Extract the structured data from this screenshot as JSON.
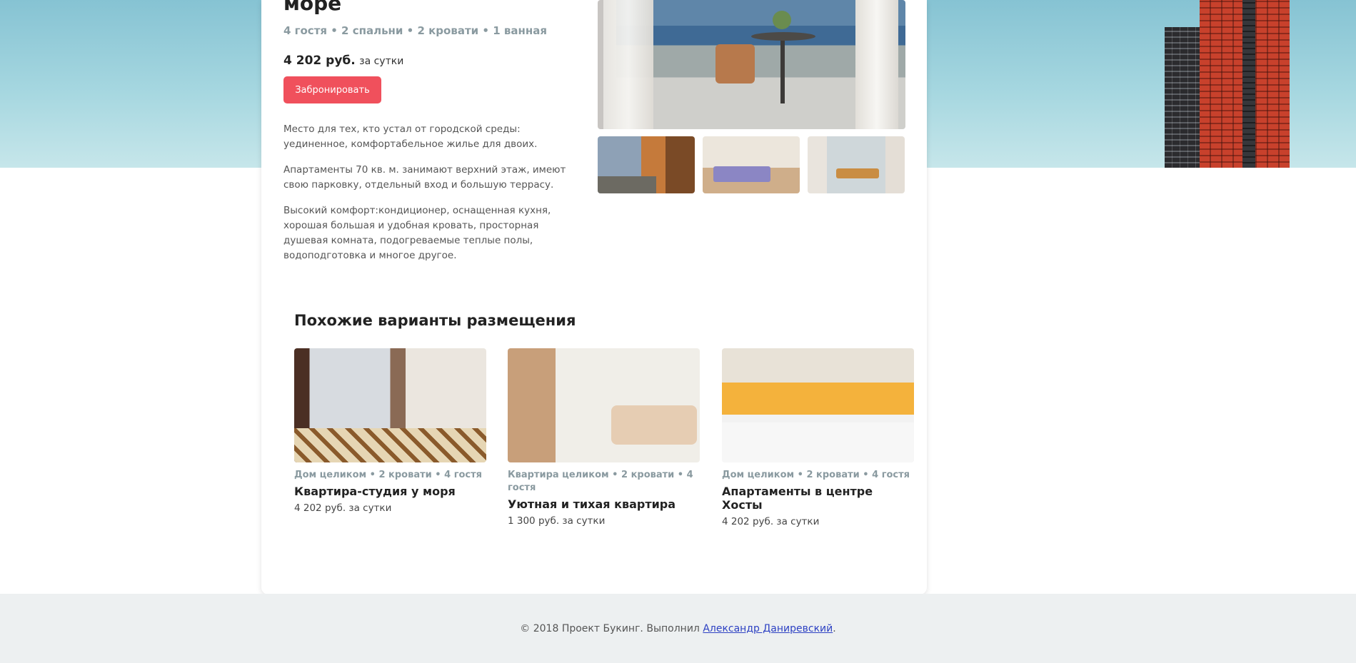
{
  "listing": {
    "title": "море",
    "specs": "4 гостя • 2 спальни • 2 кровати • 1 ванная",
    "price_amount": "4 202 руб.",
    "price_period": "за сутки",
    "book_label": "Забронировать",
    "description": [
      "Место для тех, кто устал от городской среды: уединенное, комфортабельное жилье для двоих.",
      "Апартаменты 70 кв. м. занимают верхний этаж, имеют свою парковку, отдельный вход и большую террасу.",
      "Высокий комфорт:кондиционер, оснащенная кухня, хорошая большая и удобная кровать, просторная душевая комната, подогреваемые теплые полы, водоподготовка и многое другое."
    ]
  },
  "similar": {
    "heading": "Похожие варианты размещения",
    "items": [
      {
        "meta": "Дом целиком • 2 кровати • 4 гостя",
        "name": "Квартира-студия у моря",
        "price": "4 202 руб. за сутки"
      },
      {
        "meta": "Квартира целиком • 2 кровати • 4 гостя",
        "name": "Уютная и тихая квартира",
        "price": "1 300 руб. за сутки"
      },
      {
        "meta": "Дом целиком • 2 кровати • 4 гостя",
        "name": "Апартаменты в центре Хосты",
        "price": "4 202 руб. за сутки"
      }
    ]
  },
  "footer": {
    "prefix": "© 2018 Проект Букинг. Выполнил",
    "author": "Александр Даниревский",
    "suffix": "."
  },
  "colors": {
    "accent": "#f0505c",
    "muted": "#8a9aa0",
    "link": "#2d41c3",
    "footer_bg": "#edf0f1"
  }
}
